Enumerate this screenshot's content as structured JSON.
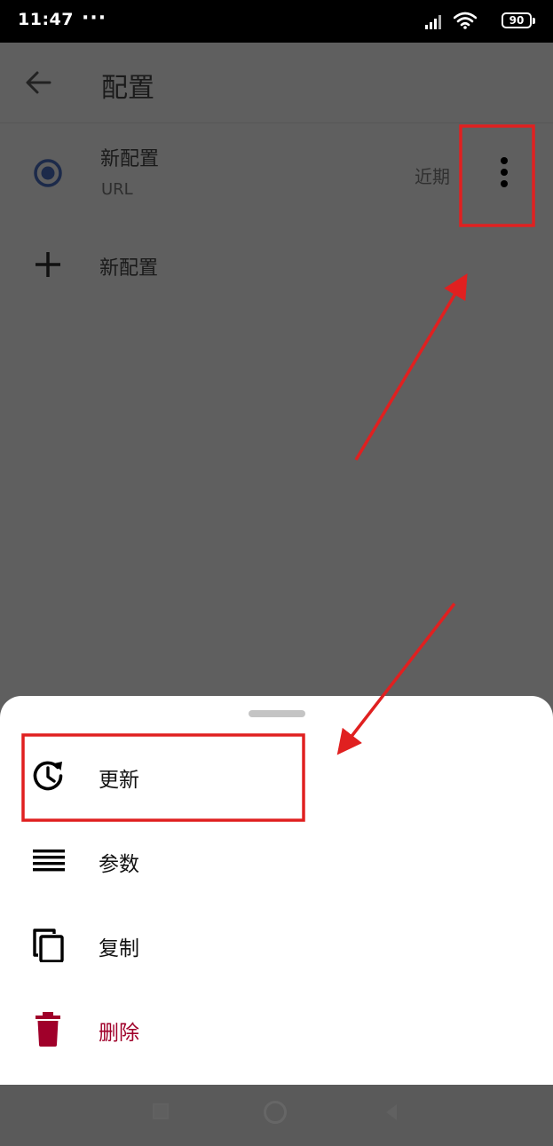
{
  "status_bar": {
    "time": "11:47",
    "more": "···",
    "battery": "90"
  },
  "app_bar": {
    "title": "配置",
    "back_icon": "arrow-left-icon"
  },
  "profile": {
    "name": "新配置",
    "subtitle": "URL",
    "date": "近期",
    "selected": true
  },
  "new_profile": {
    "label": "新配置"
  },
  "sheet": {
    "items": [
      {
        "label": "更新",
        "icon": "update-clock-icon"
      },
      {
        "label": "参数",
        "icon": "lines-icon"
      },
      {
        "label": "复制",
        "icon": "copy-icon"
      },
      {
        "label": "删除",
        "icon": "trash-icon"
      }
    ]
  },
  "colors": {
    "scrim": "#5f5f5f",
    "danger": "#a0002a",
    "annotation": "#e02020",
    "radio": "#1c2a4a"
  }
}
